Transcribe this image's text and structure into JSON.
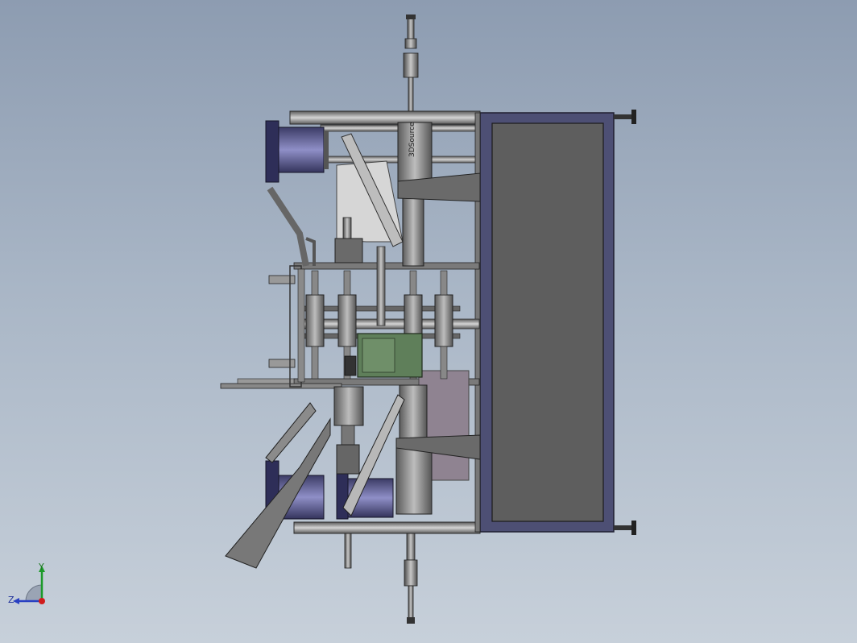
{
  "model": {
    "watermark": "3DSource"
  },
  "triad": {
    "y_label": "Y",
    "z_label": "Z"
  }
}
